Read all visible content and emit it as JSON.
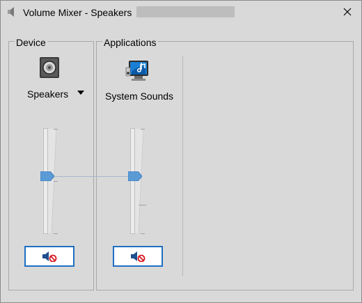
{
  "window": {
    "title": "Volume Mixer - Speakers"
  },
  "device": {
    "group_label": "Device",
    "name": "Speakers",
    "volume_percent": 55,
    "peak_percent": 55
  },
  "applications": {
    "group_label": "Applications",
    "items": [
      {
        "name": "System Sounds",
        "volume_percent": 55
      }
    ]
  },
  "icons": {
    "title": "speaker-icon",
    "close": "close-icon",
    "device": "speaker-device-icon",
    "app": "system-sounds-icon",
    "mute": "speaker-muted-icon"
  },
  "colors": {
    "accent": "#1e6fc3",
    "thumb": "#5b9bd5",
    "mute_badge": "#d71920"
  }
}
